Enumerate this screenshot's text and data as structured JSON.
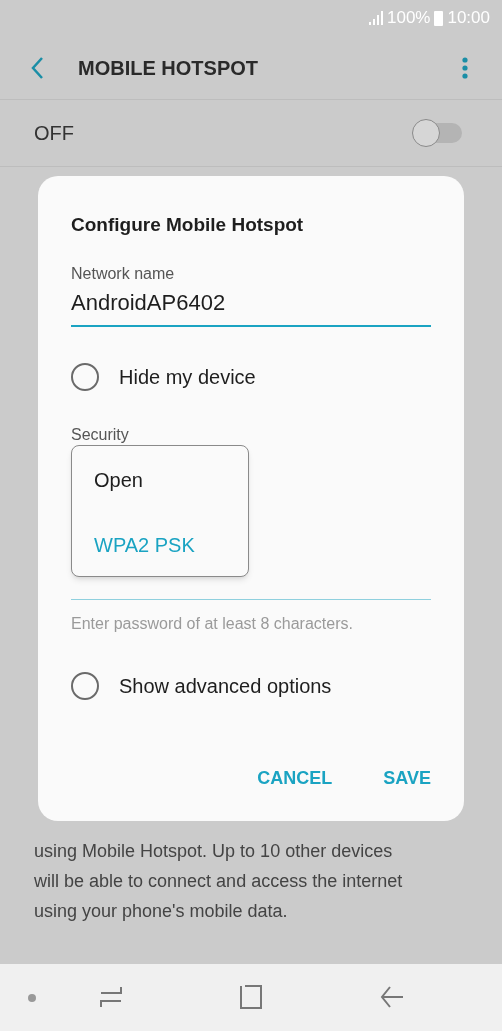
{
  "status_bar": {
    "battery": "100%",
    "time": "10:00"
  },
  "header": {
    "title": "MOBILE HOTSPOT"
  },
  "master_switch": {
    "label": "OFF",
    "on": false
  },
  "description_lines": [
    "using Mobile Hotspot. Up to 10 other devices",
    "will be able to connect and access the internet",
    "using your phone's mobile data."
  ],
  "dialog": {
    "title": "Configure Mobile Hotspot",
    "network_name": {
      "label": "Network name",
      "value": "AndroidAP6402"
    },
    "hide_device": {
      "label": "Hide my device",
      "checked": false
    },
    "security": {
      "label": "Security",
      "options": [
        {
          "label": "Open",
          "selected": false
        },
        {
          "label": "WPA2 PSK",
          "selected": true
        }
      ]
    },
    "password": {
      "hint": "Enter password of at least 8 characters."
    },
    "advanced": {
      "label": "Show advanced options",
      "checked": false
    },
    "buttons": [
      "CANCEL",
      "SAVE"
    ]
  }
}
